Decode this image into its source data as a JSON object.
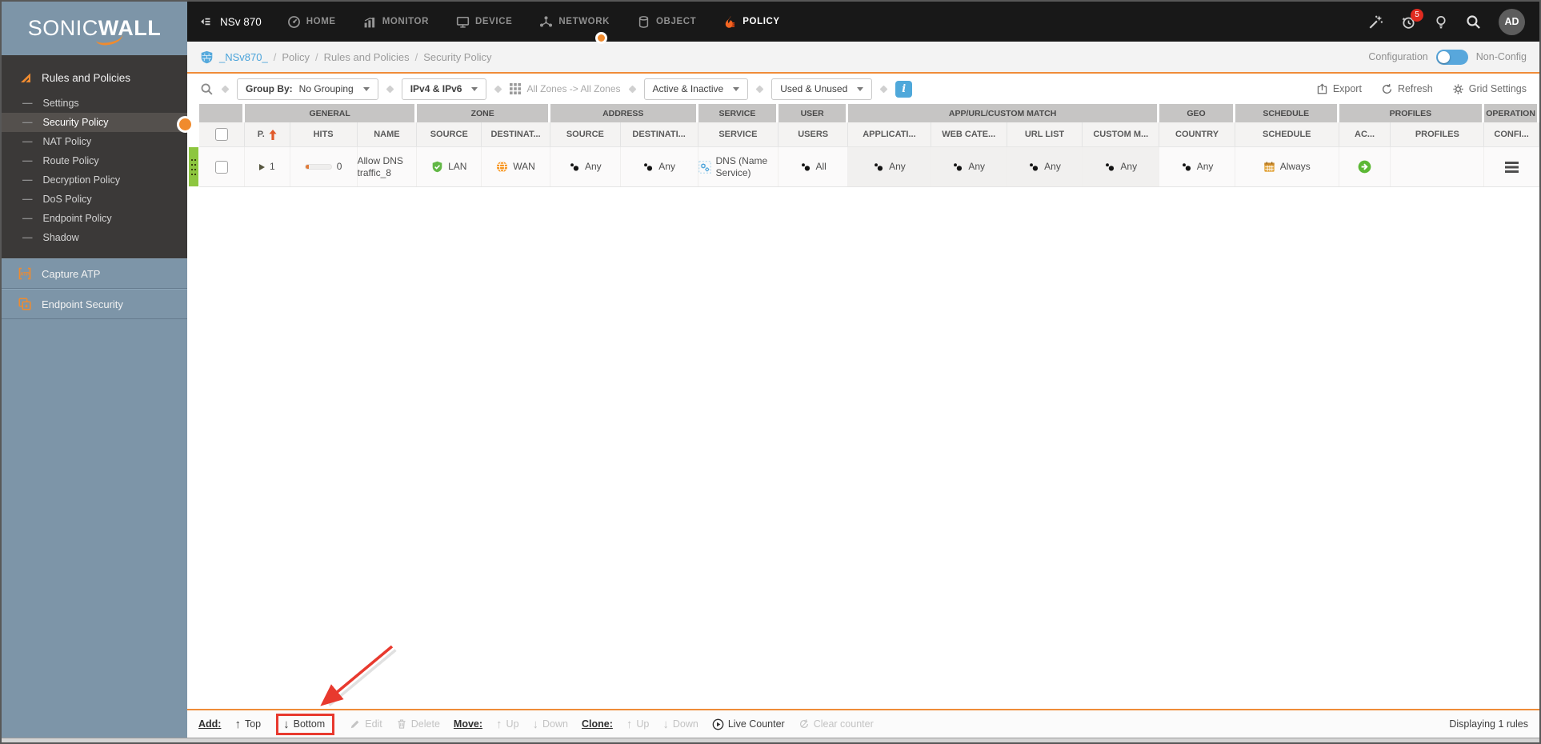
{
  "brand": {
    "logo": "SONICWALL",
    "device": "NSv 870"
  },
  "topnav": {
    "items": [
      {
        "label": "HOME",
        "icon": "home-icon",
        "active": false
      },
      {
        "label": "MONITOR",
        "icon": "monitor-icon",
        "active": false
      },
      {
        "label": "DEVICE",
        "icon": "device-icon",
        "active": false
      },
      {
        "label": "NETWORK",
        "icon": "network-icon",
        "active": false
      },
      {
        "label": "OBJECT",
        "icon": "object-icon",
        "active": false
      },
      {
        "label": "POLICY",
        "icon": "policy-icon",
        "active": true
      }
    ],
    "notifications_badge": "5",
    "avatar": "AD"
  },
  "breadcrumb": {
    "device": "_NSv870_",
    "path": [
      "Policy",
      "Rules and Policies",
      "Security Policy"
    ],
    "mode_left": "Configuration",
    "mode_right": "Non-Config"
  },
  "sidebar": {
    "section": "Rules and Policies",
    "items": [
      "Settings",
      "Security Policy",
      "NAT Policy",
      "Route Policy",
      "Decryption Policy",
      "DoS Policy",
      "Endpoint Policy",
      "Shadow"
    ],
    "active": "Security Policy",
    "extras": [
      "Capture ATP",
      "Endpoint Security"
    ]
  },
  "filters": {
    "group_by_label": "Group By:",
    "group_by_value": "No Grouping",
    "ip_version": "IPv4 & IPv6",
    "zones": "All Zones -> All Zones",
    "state": "Active & Inactive",
    "usage": "Used & Unused",
    "export": "Export",
    "refresh": "Refresh",
    "grid_settings": "Grid Settings"
  },
  "table": {
    "groups": [
      {
        "label": "",
        "span": 1
      },
      {
        "label": "GENERAL",
        "span": 3
      },
      {
        "label": "ZONE",
        "span": 2
      },
      {
        "label": "ADDRESS",
        "span": 2
      },
      {
        "label": "SERVICE",
        "span": 1
      },
      {
        "label": "USER",
        "span": 1
      },
      {
        "label": "APP/URL/CUSTOM MATCH",
        "span": 4
      },
      {
        "label": "GEO",
        "span": 1
      },
      {
        "label": "SCHEDULE",
        "span": 1
      },
      {
        "label": "PROFILES",
        "span": 2
      },
      {
        "label": "OPERATION",
        "span": 1
      }
    ],
    "columns": [
      "",
      "P.",
      "HITS",
      "NAME",
      "SOURCE",
      "DESTINAT...",
      "SOURCE",
      "DESTINATI...",
      "SERVICE",
      "USERS",
      "APPLICATI...",
      "WEB CATE...",
      "URL LIST",
      "CUSTOM M...",
      "COUNTRY",
      "SCHEDULE",
      "AC...",
      "PROFILES",
      "CONFI..."
    ],
    "sorted_column": "P.",
    "row": {
      "priority": "1",
      "hits": "0",
      "name": "Allow DNS traffic_8",
      "zone_source": {
        "icon": "lan-shield-icon",
        "label": "LAN"
      },
      "zone_dest": {
        "icon": "wan-globe-icon",
        "label": "WAN"
      },
      "addr_source": {
        "icon": "any-users-icon",
        "label": "Any"
      },
      "addr_dest": {
        "icon": "any-users-icon",
        "label": "Any"
      },
      "service": {
        "icon": "service-gears-icon",
        "label": "DNS (Name Service)"
      },
      "users": {
        "icon": "any-users-icon",
        "label": "All"
      },
      "application": {
        "icon": "any-users-icon",
        "label": "Any"
      },
      "web_category": {
        "icon": "any-users-icon",
        "label": "Any"
      },
      "url_list": {
        "icon": "any-users-icon",
        "label": "Any"
      },
      "custom_match": {
        "icon": "any-users-icon",
        "label": "Any"
      },
      "country": {
        "icon": "any-users-icon",
        "label": "Any"
      },
      "schedule": {
        "icon": "calendar-icon",
        "label": "Always"
      },
      "action": {
        "icon": "allow-action-icon",
        "label": ""
      }
    }
  },
  "bottombar": {
    "add": "Add:",
    "top": "Top",
    "bottom": "Bottom",
    "edit": "Edit",
    "del": "Delete",
    "move": "Move:",
    "move_up": "Up",
    "move_down": "Down",
    "clone": "Clone:",
    "clone_up": "Up",
    "clone_down": "Down",
    "live": "Live Counter",
    "clear": "Clear counter"
  },
  "status": "Displaying 1 rules",
  "colors": {
    "accent_orange": "#ef8c39",
    "link_blue": "#4aa3da",
    "toggle_blue": "#58a7dc",
    "badge_red": "#e02b20",
    "row_green": "#8dc63f",
    "annotation_red": "#e8392e"
  }
}
